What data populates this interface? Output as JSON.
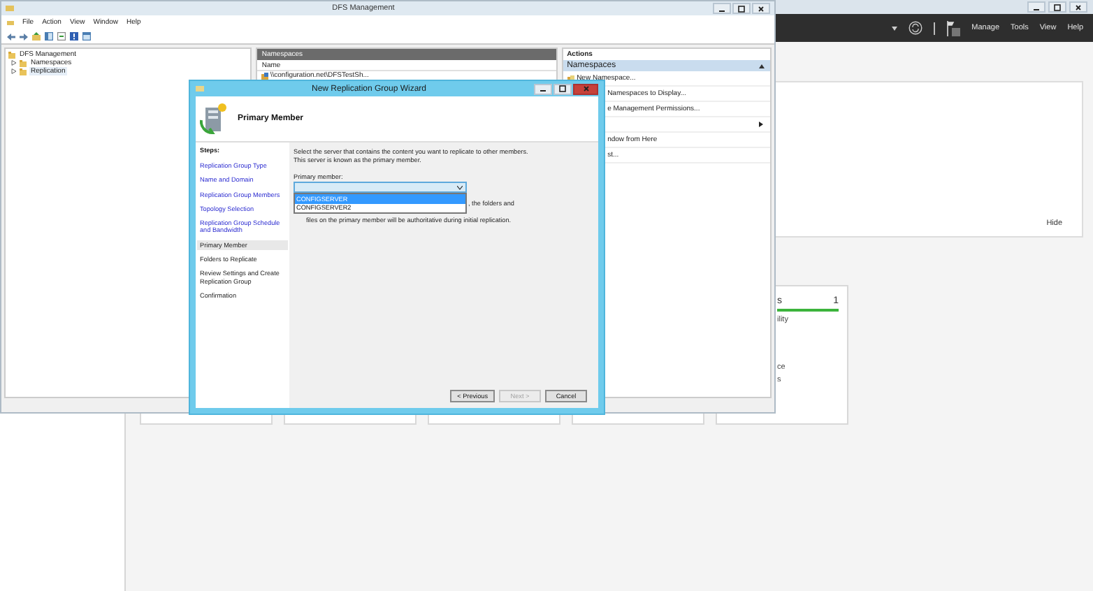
{
  "server_manager": {
    "menu": [
      {
        "label": "Manage"
      },
      {
        "label": "Tools"
      },
      {
        "label": "View"
      },
      {
        "label": "Help"
      }
    ],
    "panel": {
      "action": "Hide"
    },
    "tile": {
      "title": "s",
      "count": "1",
      "lines": [
        "ility",
        "ce",
        "s"
      ]
    }
  },
  "dfs_window": {
    "title": "DFS Management",
    "menu": [
      {
        "label": "File"
      },
      {
        "label": "Action"
      },
      {
        "label": "View"
      },
      {
        "label": "Window"
      },
      {
        "label": "Help"
      }
    ],
    "tree": [
      {
        "label": "DFS Management",
        "selected": false,
        "children": [
          {
            "label": "Namespaces",
            "selected": false,
            "expanded": false
          },
          {
            "label": "Replication",
            "selected": true,
            "expanded": false
          }
        ]
      }
    ],
    "namespaces_pane": {
      "title": "Namespaces",
      "column": "Name",
      "rows": [
        "\\\\configuration.net\\DFSTestSh..."
      ]
    },
    "actions": {
      "title": "Actions",
      "section": "Namespaces",
      "items": [
        {
          "kind": "command",
          "label": "New Namespace..."
        },
        {
          "kind": "cut",
          "label": "Namespaces to Display..."
        },
        {
          "kind": "cut",
          "label": "e Management Permissions..."
        },
        {
          "kind": "submenu"
        },
        {
          "kind": "cut",
          "label": "ndow from Here"
        },
        {
          "kind": "cut",
          "label": "st..."
        }
      ]
    }
  },
  "wizard": {
    "title": "New Replication Group Wizard",
    "page_title": "Primary Member",
    "steps_heading": "Steps:",
    "steps": [
      {
        "label": "Replication Group Type",
        "completed": true,
        "selected": false
      },
      {
        "label": "Name and Domain",
        "completed": true,
        "selected": false
      },
      {
        "label": "Replication Group Members",
        "completed": true,
        "selected": false
      },
      {
        "label": "Topology Selection",
        "completed": true,
        "selected": false
      },
      {
        "label": "Replication Group Schedule and Bandwidth",
        "completed": true,
        "selected": false
      },
      {
        "label": "Primary Member",
        "completed": false,
        "selected": true
      },
      {
        "label": "Folders to Replicate",
        "completed": false,
        "selected": false
      },
      {
        "label": "Review Settings and Create Replication Group",
        "completed": false,
        "selected": false
      },
      {
        "label": "Confirmation",
        "completed": false,
        "selected": false
      }
    ],
    "intro": [
      "Select the server that contains the content you want to replicate to other members.",
      "This server is known as the primary member."
    ],
    "field": {
      "label": "Primary member:",
      "expanded": true,
      "options": [
        {
          "label": "CONFIGSERVER",
          "selected": true
        },
        {
          "label": "CONFIGSERVER2",
          "selected": false
        }
      ]
    },
    "note": [
      ", the folders and",
      "files on the primary member will be authoritative during initial replication."
    ],
    "buttons": [
      {
        "label": "< Previous",
        "disabled": false
      },
      {
        "label": "Next >",
        "disabled": true
      },
      {
        "label": "Cancel",
        "disabled": false
      }
    ]
  }
}
